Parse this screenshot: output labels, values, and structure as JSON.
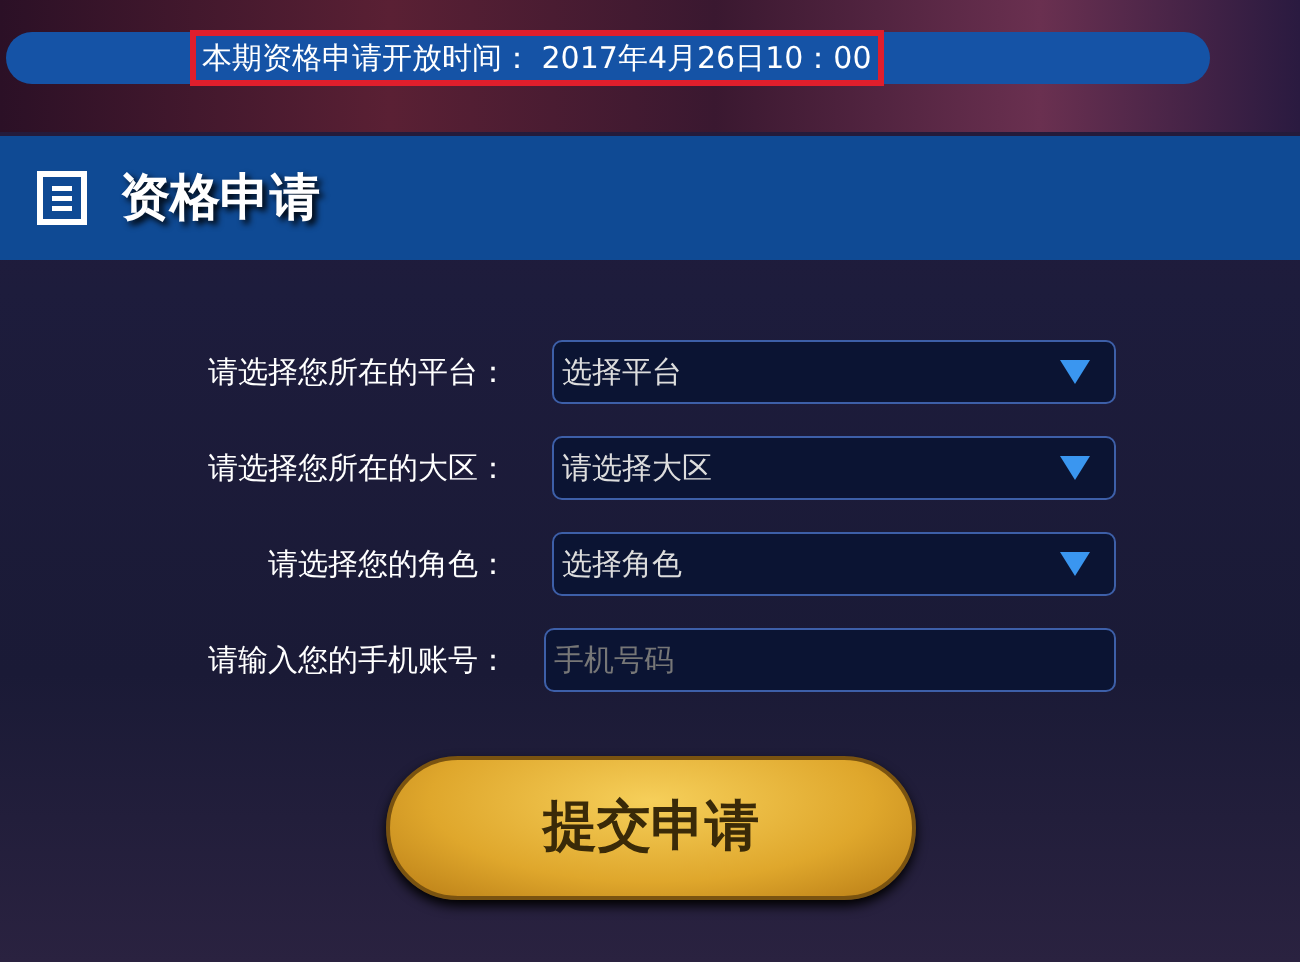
{
  "notice": {
    "text": "本期资格申请开放时间： 2017年4月26日10：00",
    "highlighted": true
  },
  "panel": {
    "title": "资格申请"
  },
  "fields": [
    {
      "kind": "select",
      "label": "请选择您所在的平台：",
      "value": "选择平台"
    },
    {
      "kind": "select",
      "label": "请选择您所在的大区：",
      "value": "请选择大区"
    },
    {
      "kind": "select",
      "label": "请选择您的角色：",
      "value": "选择角色"
    },
    {
      "kind": "input",
      "label": "请输入您的手机账号：",
      "placeholder": "手机号码"
    }
  ],
  "submit": {
    "label": "提交申请"
  }
}
